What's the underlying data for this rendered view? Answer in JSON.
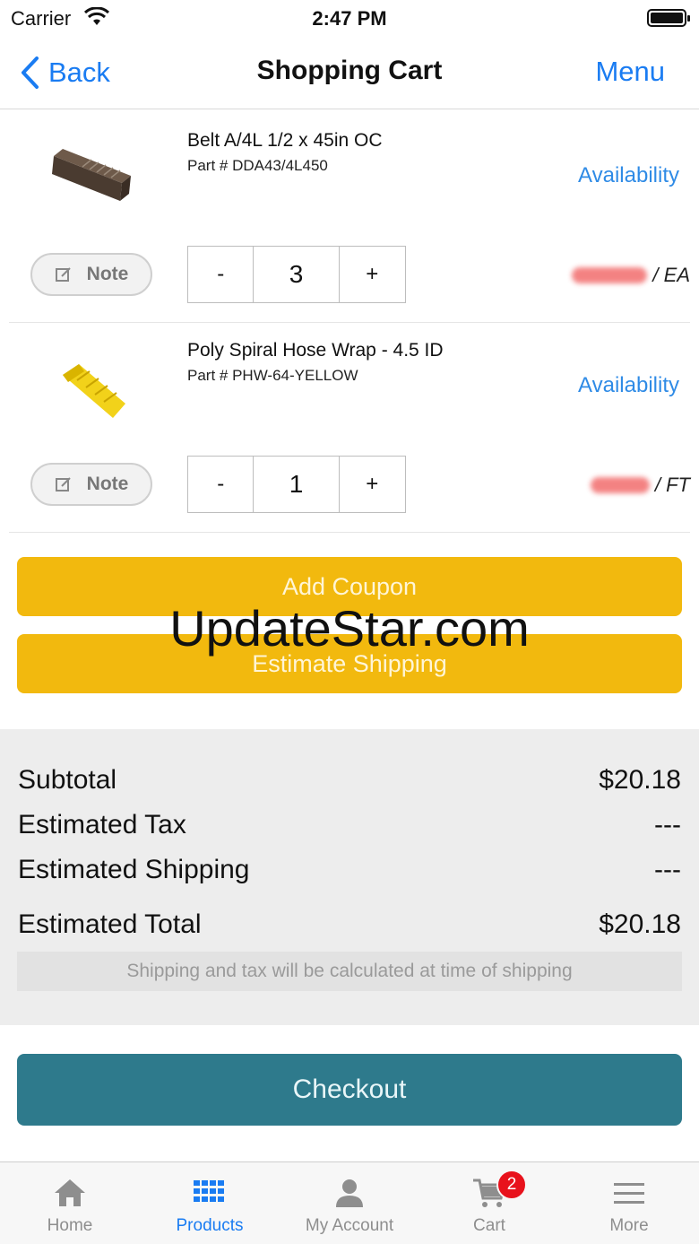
{
  "status_bar": {
    "carrier": "Carrier",
    "time": "2:47 PM"
  },
  "nav": {
    "back_label": "Back",
    "title": "Shopping Cart",
    "menu_label": "Menu"
  },
  "items": [
    {
      "name": "Belt A/4L 1/2 x 45in OC",
      "part": "Part # DDA43/4L450",
      "availability": "Availability",
      "note_label": "Note",
      "quantity": "3",
      "minus": "-",
      "plus": "+",
      "price_unit": "/ EA"
    },
    {
      "name": "Poly Spiral Hose Wrap - 4.5 ID",
      "part": "Part # PHW-64-YELLOW",
      "availability": "Availability",
      "note_label": "Note",
      "quantity": "1",
      "minus": "-",
      "plus": "+",
      "price_unit": "/ FT"
    }
  ],
  "buttons": {
    "add_coupon": "Add Coupon",
    "estimate_shipping": "Estimate Shipping",
    "checkout": "Checkout"
  },
  "watermark": "UpdateStar.com",
  "summary": {
    "subtotal_label": "Subtotal",
    "subtotal_value": "$20.18",
    "tax_label": "Estimated Tax",
    "tax_value": "---",
    "shipping_label": "Estimated Shipping",
    "shipping_value": "---",
    "total_label": "Estimated Total",
    "total_value": "$20.18",
    "note": "Shipping and tax will be calculated at time of shipping"
  },
  "tabs": [
    {
      "label": "Home",
      "icon": "home-icon"
    },
    {
      "label": "Products",
      "icon": "grid-icon",
      "active": true
    },
    {
      "label": "My Account",
      "icon": "person-icon"
    },
    {
      "label": "Cart",
      "icon": "cart-icon",
      "badge": "2"
    },
    {
      "label": "More",
      "icon": "hamburger-icon"
    }
  ],
  "colors": {
    "accent_blue": "#1a7cf2",
    "yellow": "#f2b90e",
    "checkout_teal": "#2e7a8c",
    "badge_red": "#e8121c"
  }
}
